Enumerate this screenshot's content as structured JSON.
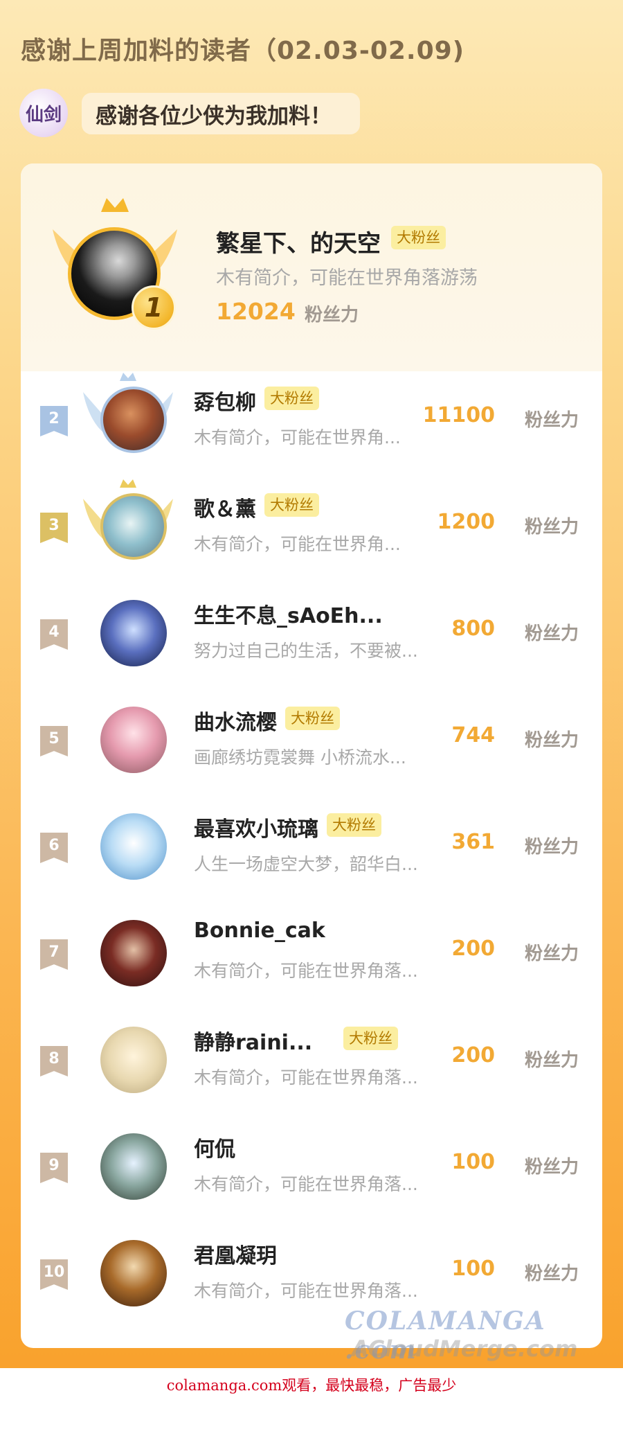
{
  "header": {
    "title": "感谢上周加料的读者（02.03-02.09)",
    "logo_text": "仙剑",
    "banner": "感谢各位少侠为我加料！"
  },
  "top_fan": {
    "rank": "1",
    "name": "繁星下、的天空",
    "tag": "大粉丝",
    "bio": "木有简介，可能在世界角落游荡",
    "score": "12024",
    "unit": "粉丝力"
  },
  "fans": [
    {
      "rank": "2",
      "name": "孬包柳",
      "tag": "大粉丝",
      "bio": "木有简介，可能在世界角...",
      "score": "11100",
      "unit": "粉丝力"
    },
    {
      "rank": "3",
      "name": "歌＆薰",
      "tag": "大粉丝",
      "bio": "木有简介，可能在世界角...",
      "score": "1200",
      "unit": "粉丝力"
    },
    {
      "rank": "4",
      "name": "生生不息_sAoEh...",
      "tag": "",
      "bio": "努力过自己的生活，不要被...",
      "score": "800",
      "unit": "粉丝力"
    },
    {
      "rank": "5",
      "name": "曲水流樱",
      "tag": "大粉丝",
      "bio": "画廊绣坊霓裳舞 小桥流水...",
      "score": "744",
      "unit": "粉丝力"
    },
    {
      "rank": "6",
      "name": "最喜欢小琉璃",
      "tag": "大粉丝",
      "bio": "人生一场虚空大梦，韶华白...",
      "score": "361",
      "unit": "粉丝力"
    },
    {
      "rank": "7",
      "name": "Bonnie_cak",
      "tag": "",
      "bio": "木有简介，可能在世界角落...",
      "score": "200",
      "unit": "粉丝力"
    },
    {
      "rank": "8",
      "name": "静静raini...",
      "tag": "大粉丝",
      "bio": "木有简介，可能在世界角落...",
      "score": "200",
      "unit": "粉丝力"
    },
    {
      "rank": "9",
      "name": "何侃",
      "tag": "",
      "bio": "木有简介，可能在世界角落...",
      "score": "100",
      "unit": "粉丝力"
    },
    {
      "rank": "10",
      "name": "君凰凝玥",
      "tag": "",
      "bio": "木有简介，可能在世界角落...",
      "score": "100",
      "unit": "粉丝力"
    }
  ],
  "watermark": {
    "line1": "COLAMANGA .com",
    "line2": "ACloudMerge.com"
  },
  "footer": "colamanga.com观看，最快最稳，广告最少",
  "colors": {
    "accent": "#f2a934",
    "tag_bg": "#fbeea0",
    "rank_default": "#cdb8a4",
    "rank_2": "#a9c3e3",
    "rank_3": "#dcc064"
  }
}
